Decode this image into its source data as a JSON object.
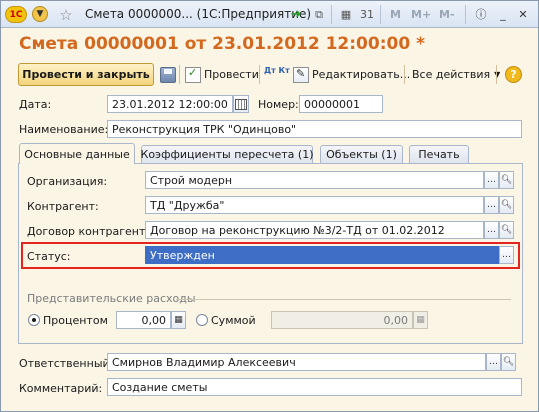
{
  "window": {
    "title": "Смета 0000000... (1С:Предприятие)",
    "toolbar_items": [
      "M",
      "M+",
      "M-"
    ]
  },
  "heading": "Смета 00000001 от 23.01.2012 12:00:00 *",
  "toolbar": {
    "post_close_label": "Провести и закрыть",
    "post_label": "Провести",
    "edit_label": "Редактировать...",
    "all_actions_label": "Все действия",
    "dtkt_label": "Дт Кт"
  },
  "fields": {
    "date_label": "Дата:",
    "date_value": "23.01.2012 12:00:00",
    "number_label": "Номер:",
    "number_value": "00000001",
    "name_label": "Наименование:",
    "name_value": "Реконструкция ТРК \"Одинцово\""
  },
  "tabs": [
    {
      "label": "Основные данные",
      "active": true
    },
    {
      "label": "Коэффициенты пересчета (1)",
      "active": false
    },
    {
      "label": "Объекты (1)",
      "active": false
    },
    {
      "label": "Печать",
      "active": false
    }
  ],
  "main": {
    "org_label": "Организация:",
    "org_value": "Строй модерн",
    "contractor_label": "Контрагент:",
    "contractor_value": "ТД \"Дружба\"",
    "contract_label": "Договор контрагента:",
    "contract_value": "Договор на реконструкцию №3/2-ТД от 01.02.2012",
    "status_label": "Статус:",
    "status_value": "Утвержден",
    "section_title": "Представительские расходы",
    "percent_label": "Процентом",
    "percent_value": "0,00",
    "sum_label": "Суммой",
    "sum_value": "0,00",
    "percent_selected": true
  },
  "footer": {
    "responsible_label": "Ответственный:",
    "responsible_value": "Смирнов Владимир Алексеевич",
    "comment_label": "Комментарий:",
    "comment_value": "Создание сметы"
  },
  "colors": {
    "heading": "#d2691e",
    "status_highlight": "#e3241f",
    "selection": "#3d6dc4"
  }
}
